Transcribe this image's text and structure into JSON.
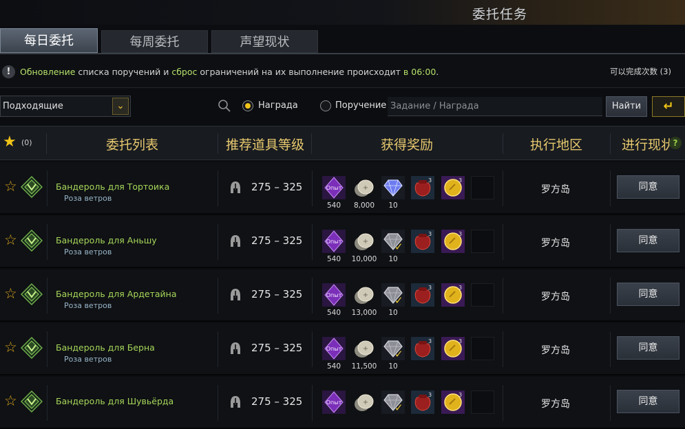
{
  "window": {
    "title": "委托任务"
  },
  "tabs": [
    {
      "label": "每日委托",
      "active": true
    },
    {
      "label": "每周委托",
      "active": false
    },
    {
      "label": "声望现状",
      "active": false
    }
  ],
  "notice": {
    "part1": "Обновление",
    "part2": " списка поручений и ",
    "part3": "сброс",
    "part4": " ограничений на их выполнение происходит ",
    "part5": "в 06:00",
    "part6": ".",
    "count": "可以完成次数 (3)"
  },
  "filter": {
    "select_value": "Подходящие",
    "radio_reward": "Награда",
    "radio_task": "Поручение",
    "search_placeholder": "Задание / Награда",
    "find_label": "Найти"
  },
  "table": {
    "fav_count": "(0)",
    "col_list": "委托列表",
    "col_item_level": "推荐道具等级",
    "col_rewards": "获得奖励",
    "col_region": "执行地区",
    "col_progress": "进行现状"
  },
  "rows": [
    {
      "name": "Бандероль для Тортоика",
      "sub": "Роза ветров",
      "range": "275 – 325",
      "exp": "540",
      "silver": "8,000",
      "gem": "10",
      "gem_claimed": false,
      "bag_count": "3",
      "coin_count": "3",
      "region": "罗方岛",
      "action": "同意"
    },
    {
      "name": "Бандероль для Аньшу",
      "sub": "Роза ветров",
      "range": "275 – 325",
      "exp": "540",
      "silver": "10,000",
      "gem": "10",
      "gem_claimed": true,
      "bag_count": "3",
      "coin_count": "3",
      "region": "罗方岛",
      "action": "同意"
    },
    {
      "name": "Бандероль для Ардетайна",
      "sub": "Роза ветров",
      "range": "275 – 325",
      "exp": "540",
      "silver": "13,000",
      "gem": "10",
      "gem_claimed": true,
      "bag_count": "3",
      "coin_count": "3",
      "region": "罗方岛",
      "action": "同意"
    },
    {
      "name": "Бандероль для Берна",
      "sub": "Роза ветров",
      "range": "275 – 325",
      "exp": "540",
      "silver": "11,500",
      "gem": "10",
      "gem_claimed": true,
      "bag_count": "3",
      "coin_count": "3",
      "region": "罗方岛",
      "action": "同意"
    },
    {
      "name": "Бандероль для Шувьёрда",
      "sub": "",
      "range": "275 – 325",
      "exp": "",
      "silver": "",
      "gem": "",
      "gem_claimed": true,
      "bag_count": "3",
      "coin_count": "3",
      "region": "罗方岛",
      "action": "同意"
    }
  ],
  "colors": {
    "accent": "#f0c419",
    "quest_name": "#a7d75a",
    "header_text": "#e7c96e"
  },
  "icons": {
    "star": "star-icon",
    "emblem": "quest-emblem-icon",
    "helm": "helmet-icon",
    "exp": "exp-crystal-icon",
    "silver": "silver-coins-icon",
    "gem": "gem-icon",
    "bag": "pouch-icon",
    "coin": "gold-coin-icon"
  },
  "reward_label": "Опыт"
}
